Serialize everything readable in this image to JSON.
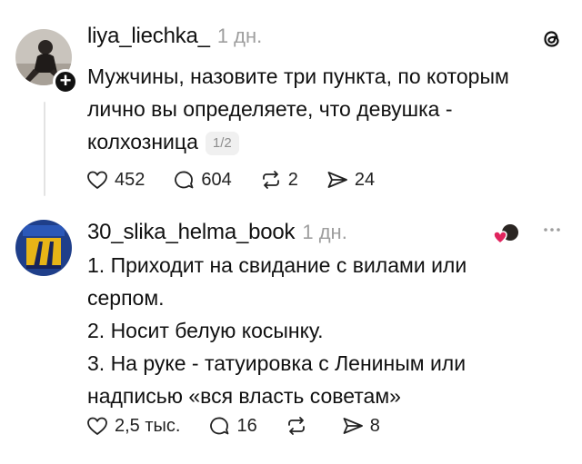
{
  "posts": [
    {
      "username": "liya_liechka_",
      "timestamp": "1 дн.",
      "lines": [
        "Мужчины, назовите три пункта, по которым",
        "лично вы определяете, что девушка -",
        "колхозница"
      ],
      "page_indicator": "1/2",
      "counts": {
        "likes": "452",
        "comments": "604",
        "reposts": "2",
        "shares": "24"
      }
    },
    {
      "username": "30_slika_helma_book",
      "timestamp": "1 дн.",
      "lines": [
        "1. Приходит на свидание с вилами или",
        "серпом.",
        "2. Носит белую косынку.",
        "3. На руке - татуировка с Лениным или",
        "надписью «вся власть советам»"
      ],
      "counts": {
        "likes": "2,5 тыс.",
        "comments": "16",
        "reposts": "",
        "shares": "8"
      }
    }
  ],
  "icons": {
    "like": "heart-icon",
    "comment": "comment-bubble-icon",
    "repost": "repost-icon",
    "share": "send-icon",
    "app": "threads-logo-icon",
    "more": "more-dots-icon"
  },
  "colors": {
    "text": "#111111",
    "muted": "#9e9e9e",
    "thread_line": "#e3e3e3",
    "reaction_heart": "#e0245e"
  }
}
